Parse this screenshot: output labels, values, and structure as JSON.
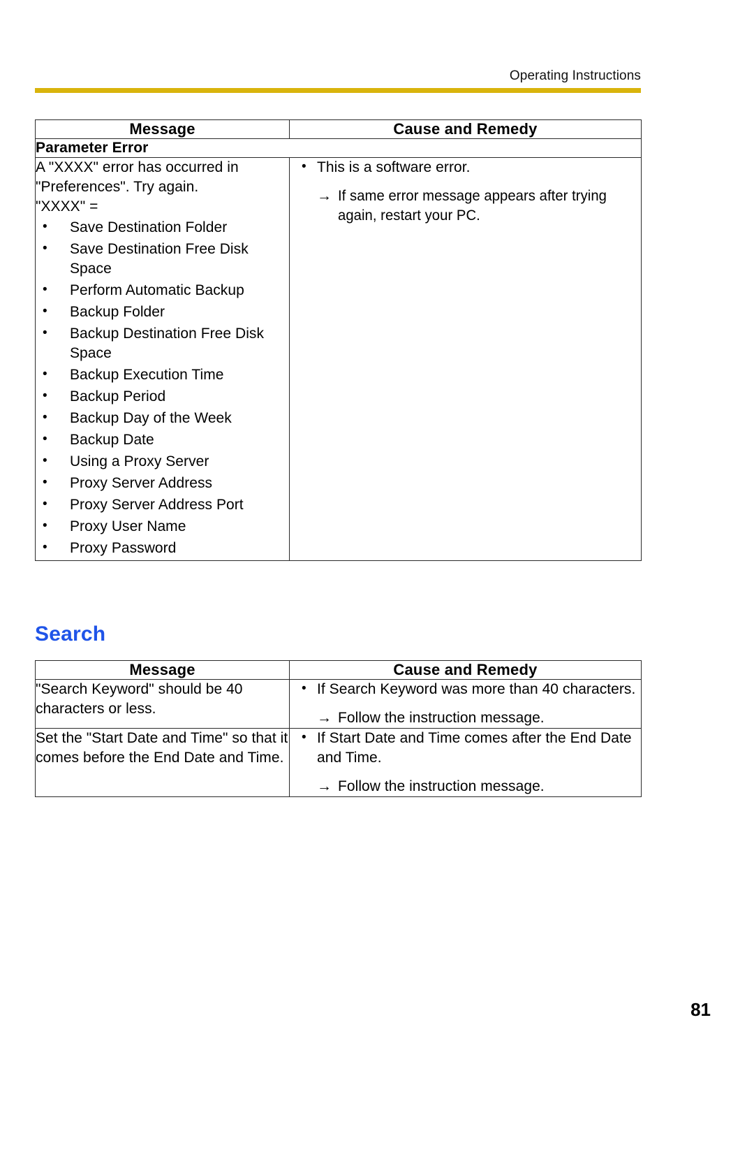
{
  "header": {
    "title": "Operating Instructions",
    "rule_color": "#d9b40c"
  },
  "tables": {
    "parameter_error": {
      "columns": [
        "Message",
        "Cause and Remedy"
      ],
      "group_label": "Parameter Error",
      "message_intro_line1": "A \"XXXX\" error has occurred in",
      "message_intro_line2": "\"Preferences\". Try again.",
      "message_intro_line3": "\"XXXX\" =",
      "message_items": [
        "Save Destination Folder",
        "Save Destination Free Disk Space",
        "Perform Automatic Backup",
        "Backup Folder",
        "Backup Destination Free Disk Space",
        "Backup Execution Time",
        "Backup Period",
        "Backup Day of the Week",
        "Backup Date",
        "Using a Proxy Server",
        "Proxy Server Address",
        "Proxy Server Address Port",
        "Proxy User Name",
        "Proxy Password"
      ],
      "cause_bullet": "This is a software error.",
      "cause_arrow": "If same error message appears after trying again, restart your PC."
    },
    "search": {
      "heading": "Search",
      "heading_color": "#1f54e8",
      "columns": [
        "Message",
        "Cause and Remedy"
      ],
      "rows": [
        {
          "message": "\"Search Keyword\" should be 40 characters or less.",
          "cause_bullet": "If Search Keyword was more than 40 characters.",
          "cause_arrow": "Follow the instruction message."
        },
        {
          "message": "Set the \"Start Date and Time\" so that it comes before the End Date and Time.",
          "cause_bullet": "If Start Date and Time comes after the End Date and Time.",
          "cause_arrow": "Follow the instruction message."
        }
      ]
    }
  },
  "footer": {
    "page_number": "81"
  },
  "icons": {
    "arrow_right": "→",
    "bullet_dot": "•"
  }
}
